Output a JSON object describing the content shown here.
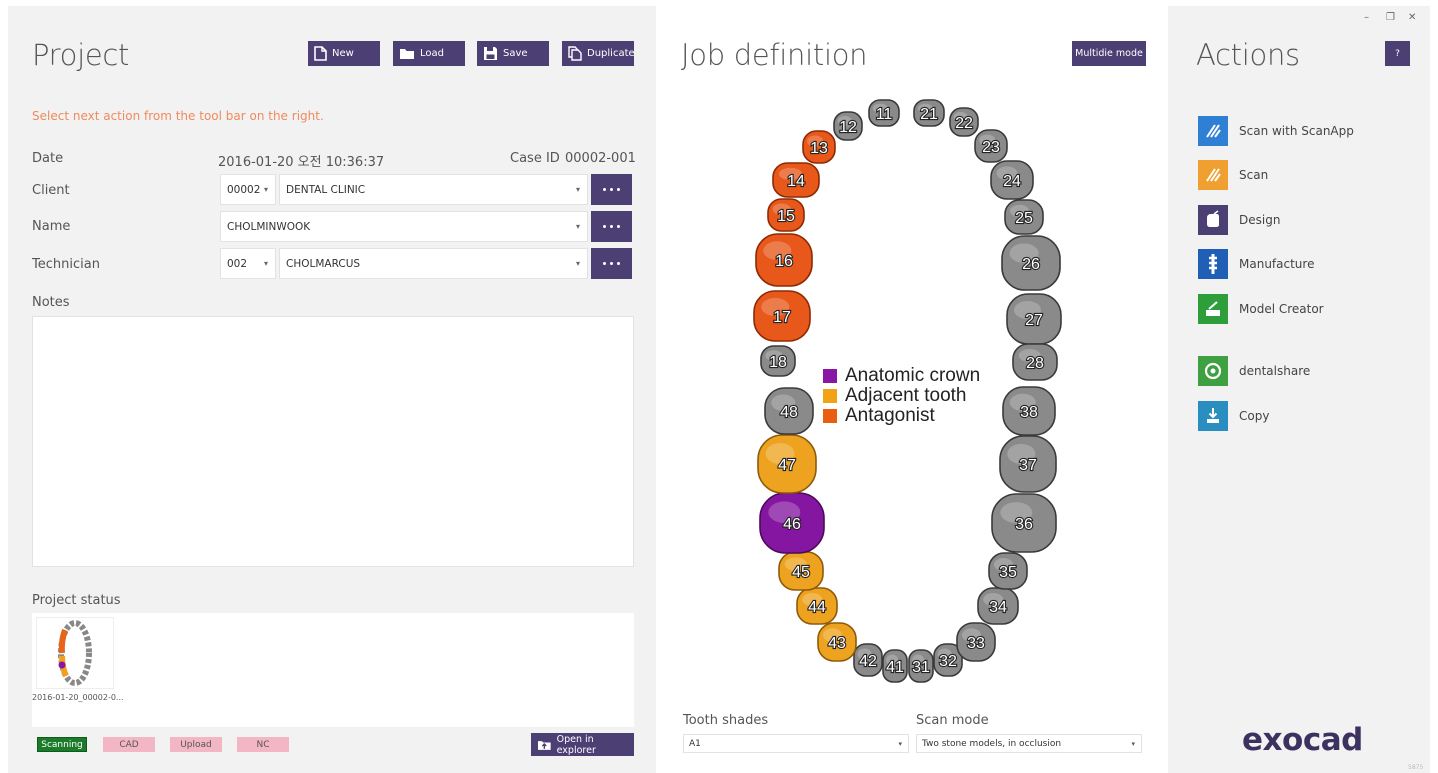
{
  "project": {
    "title": "Project",
    "buttons": {
      "new": "New",
      "load": "Load",
      "save": "Save",
      "duplicate": "Duplicate"
    },
    "hint": "Select next action from the tool bar on the right.",
    "date_label": "Date",
    "date_value": "2016-01-20 오전 10:36:37",
    "case_id_label": "Case ID",
    "case_id_value": "00002-001",
    "client_label": "Client",
    "client_code": "00002",
    "client_name": "DENTAL CLINIC",
    "name_label": "Name",
    "name_value": "CHOLMINWOOK",
    "technician_label": "Technician",
    "technician_code": "002",
    "technician_name": "CHOLMARCUS",
    "notes_label": "Notes",
    "notes_value": "",
    "status_label": "Project status",
    "thumb_caption": "2016-01-20_00002-0...",
    "status_badges": [
      "Scanning",
      "CAD",
      "Upload",
      "NC"
    ],
    "open_explorer": "Open in explorer"
  },
  "job": {
    "title": "Job definition",
    "multidie": "Multidie mode",
    "legend": [
      {
        "label": "Anatomic crown",
        "color": "#8a16a6"
      },
      {
        "label": "Adjacent tooth",
        "color": "#f1a315"
      },
      {
        "label": "Antagonist",
        "color": "#ea5e12"
      }
    ],
    "tooth_shades_label": "Tooth shades",
    "tooth_shades_value": "A1",
    "scan_mode_label": "Scan mode",
    "scan_mode_value": "Two stone models, in occlusion",
    "teeth": [
      {
        "n": "11",
        "s": "none"
      },
      {
        "n": "12",
        "s": "none"
      },
      {
        "n": "13",
        "s": "antagonist"
      },
      {
        "n": "14",
        "s": "antagonist"
      },
      {
        "n": "15",
        "s": "antagonist"
      },
      {
        "n": "16",
        "s": "antagonist"
      },
      {
        "n": "17",
        "s": "antagonist"
      },
      {
        "n": "18",
        "s": "none"
      },
      {
        "n": "21",
        "s": "none"
      },
      {
        "n": "22",
        "s": "none"
      },
      {
        "n": "23",
        "s": "none"
      },
      {
        "n": "24",
        "s": "none"
      },
      {
        "n": "25",
        "s": "none"
      },
      {
        "n": "26",
        "s": "none"
      },
      {
        "n": "27",
        "s": "none"
      },
      {
        "n": "28",
        "s": "none"
      },
      {
        "n": "31",
        "s": "none"
      },
      {
        "n": "32",
        "s": "none"
      },
      {
        "n": "33",
        "s": "none"
      },
      {
        "n": "34",
        "s": "none"
      },
      {
        "n": "35",
        "s": "none"
      },
      {
        "n": "36",
        "s": "none"
      },
      {
        "n": "37",
        "s": "none"
      },
      {
        "n": "38",
        "s": "none"
      },
      {
        "n": "41",
        "s": "none"
      },
      {
        "n": "42",
        "s": "none"
      },
      {
        "n": "43",
        "s": "adjacent"
      },
      {
        "n": "44",
        "s": "adjacent"
      },
      {
        "n": "45",
        "s": "adjacent"
      },
      {
        "n": "46",
        "s": "anatomic"
      },
      {
        "n": "47",
        "s": "adjacent"
      },
      {
        "n": "48",
        "s": "none"
      }
    ]
  },
  "actions": {
    "title": "Actions",
    "help": "?",
    "items": [
      {
        "label": "Scan with ScanApp",
        "icon": "scanapp-icon",
        "color": "#2f7fd4"
      },
      {
        "label": "Scan",
        "icon": "scan-icon",
        "color": "#f0a030"
      },
      {
        "label": "Design",
        "icon": "design-icon",
        "color": "#4c3f73"
      },
      {
        "label": "Manufacture",
        "icon": "manufacture-icon",
        "color": "#1f5fb5"
      },
      {
        "label": "Model Creator",
        "icon": "model-creator-icon",
        "color": "#2e9e3a"
      },
      {
        "label": "dentalshare",
        "icon": "dentalshare-icon",
        "color": "#3ea041"
      },
      {
        "label": "Copy",
        "icon": "copy-icon",
        "color": "#2a8fc0"
      }
    ],
    "logo": "exocad",
    "version": "5875"
  },
  "colors": {
    "accent": "#4c3f73",
    "hint": "#f08a5d",
    "none_tooth": "#8c8c8c",
    "scanning_badge": "#1c7a2b",
    "pending_badge": "#f3b6c4"
  }
}
